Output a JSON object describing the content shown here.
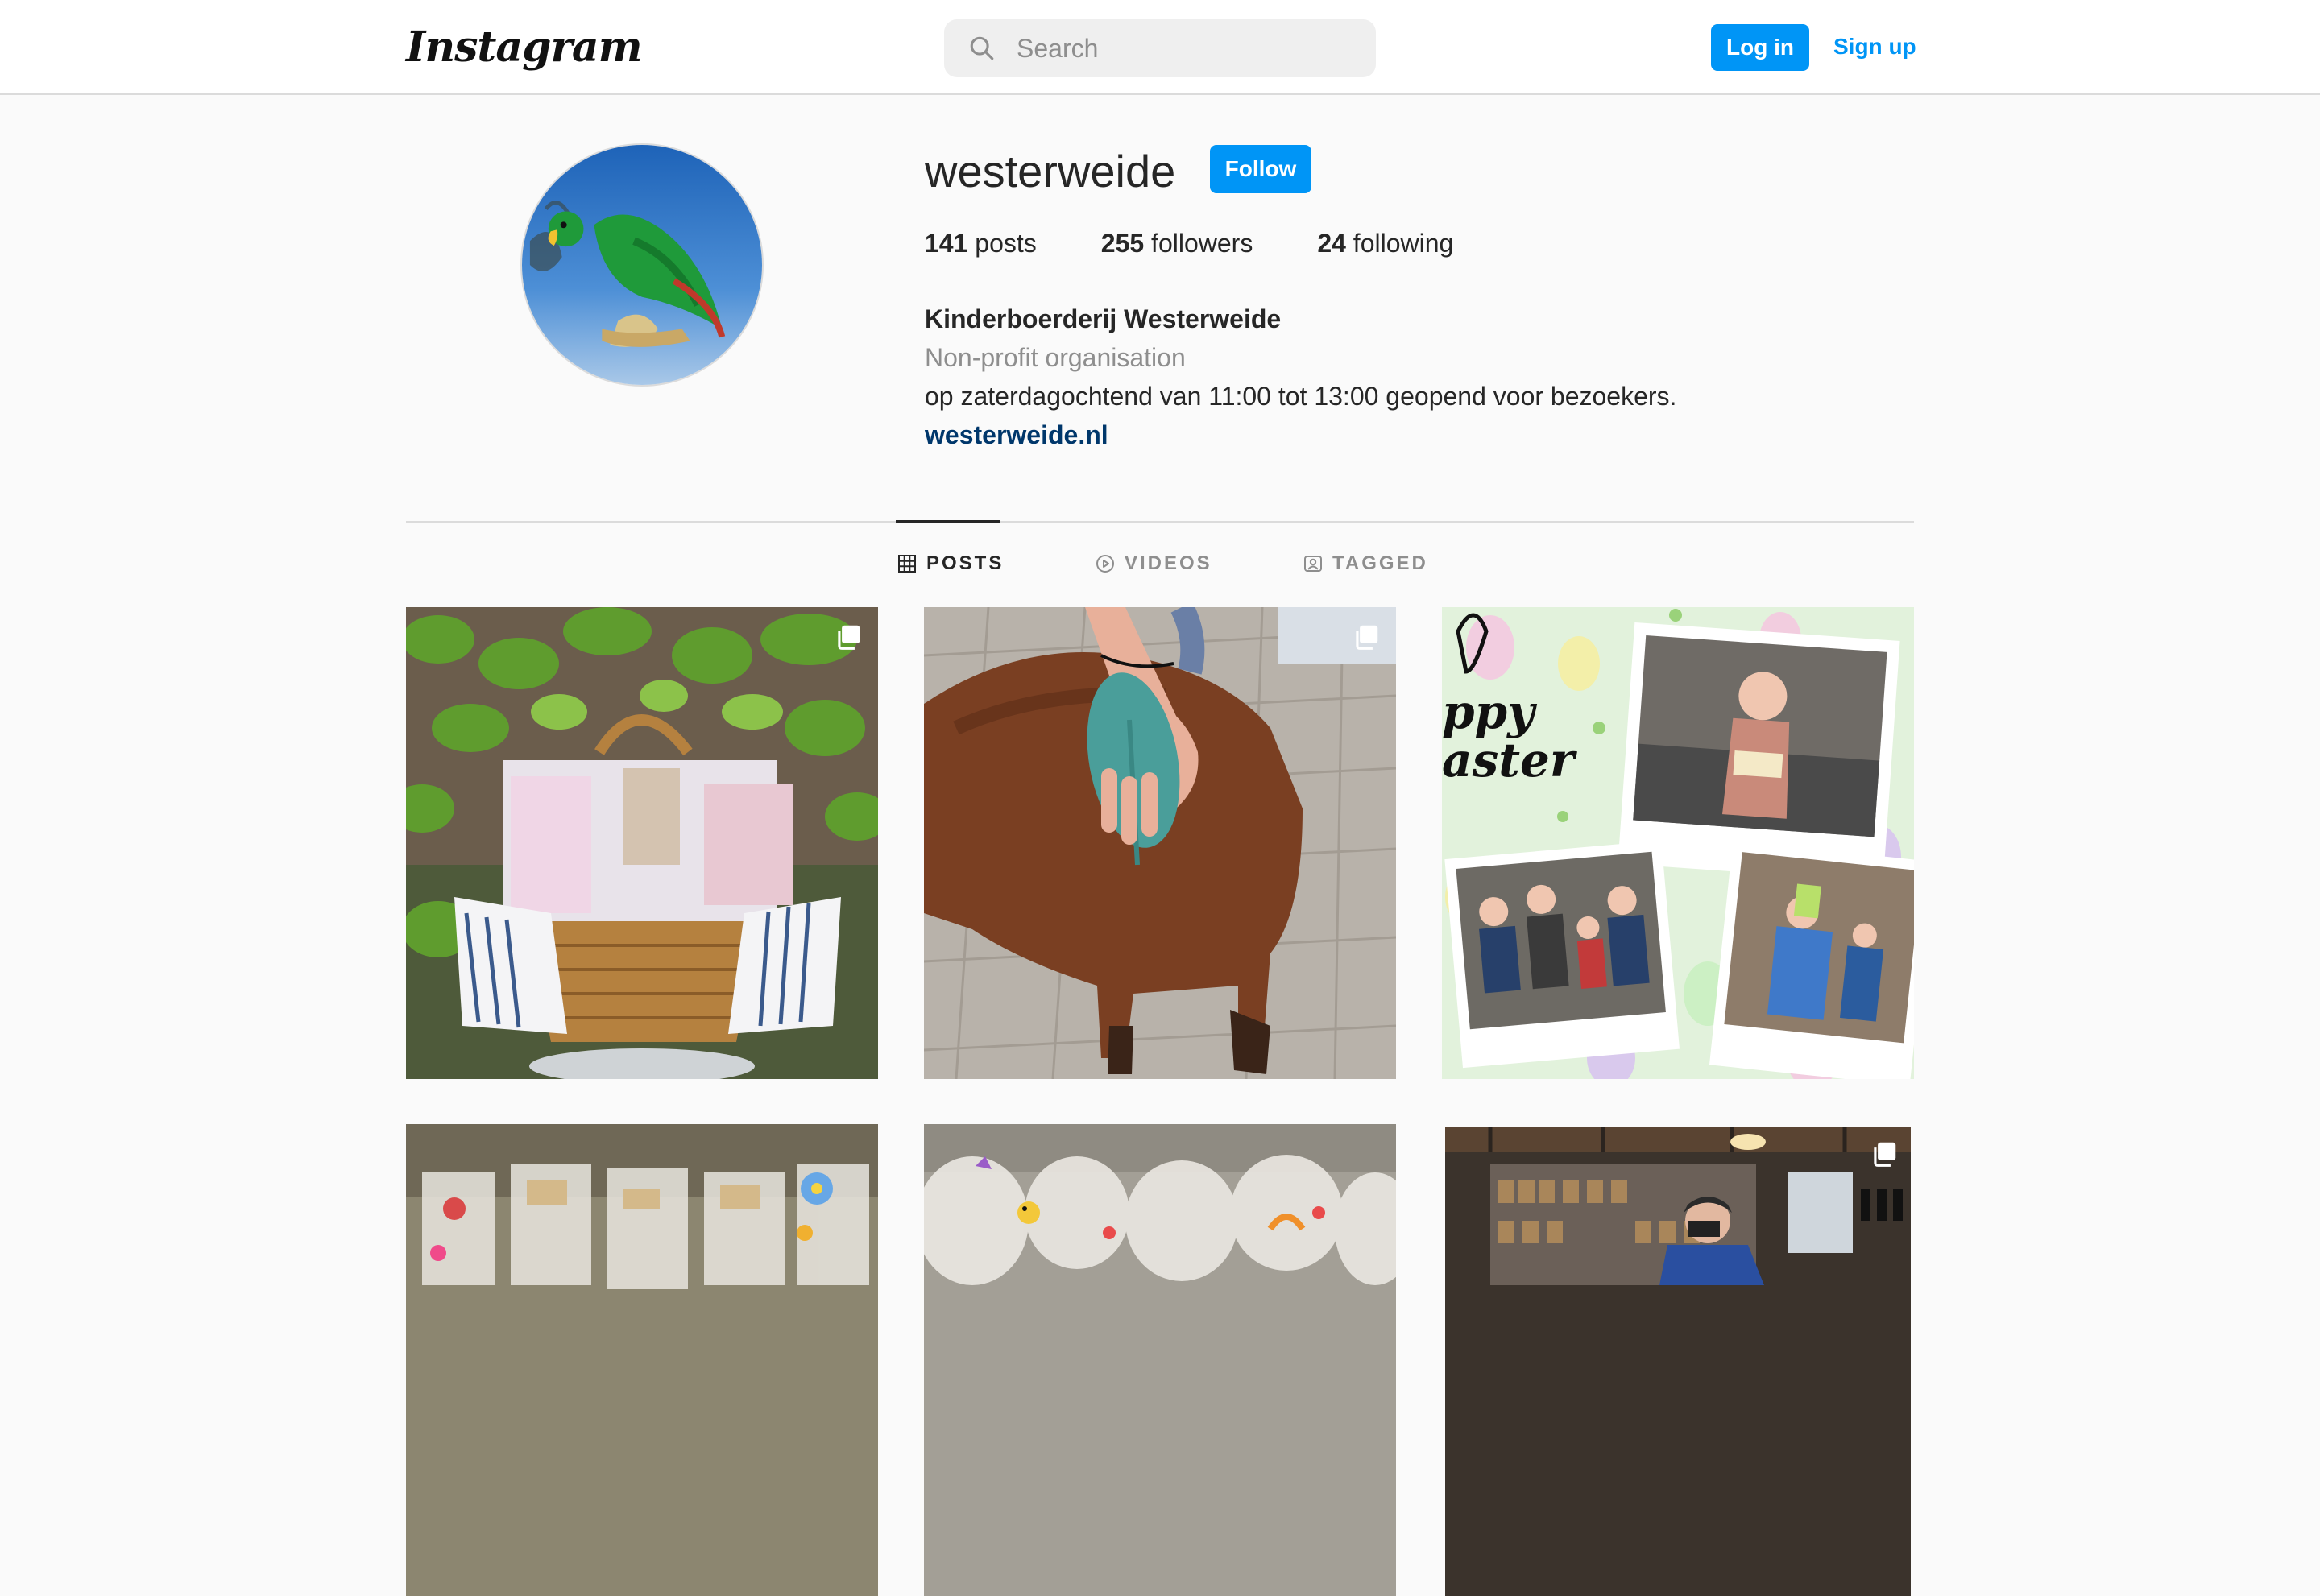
{
  "header": {
    "logo_text": "Instagram",
    "search_placeholder": "Search",
    "login_label": "Log in",
    "signup_label": "Sign up",
    "accent_color": "#0095f6"
  },
  "profile": {
    "username": "westerweide",
    "follow_label": "Follow",
    "stats": {
      "posts_count": "141",
      "posts_label": "posts",
      "followers_count": "255",
      "followers_label": "followers",
      "following_count": "24",
      "following_label": "following"
    },
    "full_name": "Kinderboerderij Westerweide",
    "category": "Non-profit organisation",
    "bio": "op zaterdagochtend van 11:00 tot 13:00 geopend voor bezoekers.",
    "website": "westerweide.nl"
  },
  "tabs": [
    {
      "label": "POSTS",
      "icon": "grid-icon",
      "active": true
    },
    {
      "label": "VIDEOS",
      "icon": "play-icon",
      "active": false
    },
    {
      "label": "TAGGED",
      "icon": "tagged-icon",
      "active": false
    }
  ],
  "posts": [
    {
      "subject": "gift basket with blue and white towels and bags in front of ivy",
      "multiple": true
    },
    {
      "subject": "hand brushing a brown calf with a teal brush",
      "multiple": true
    },
    {
      "subject": "Happy Easter collage with photos of children",
      "multiple": false
    },
    {
      "subject": "wrapped gift bags with flower stickers",
      "multiple": false
    },
    {
      "subject": "cellophane treat bags with chick stickers",
      "multiple": false
    },
    {
      "subject": "person in farm shop with shelves of jars",
      "multiple": true
    }
  ]
}
